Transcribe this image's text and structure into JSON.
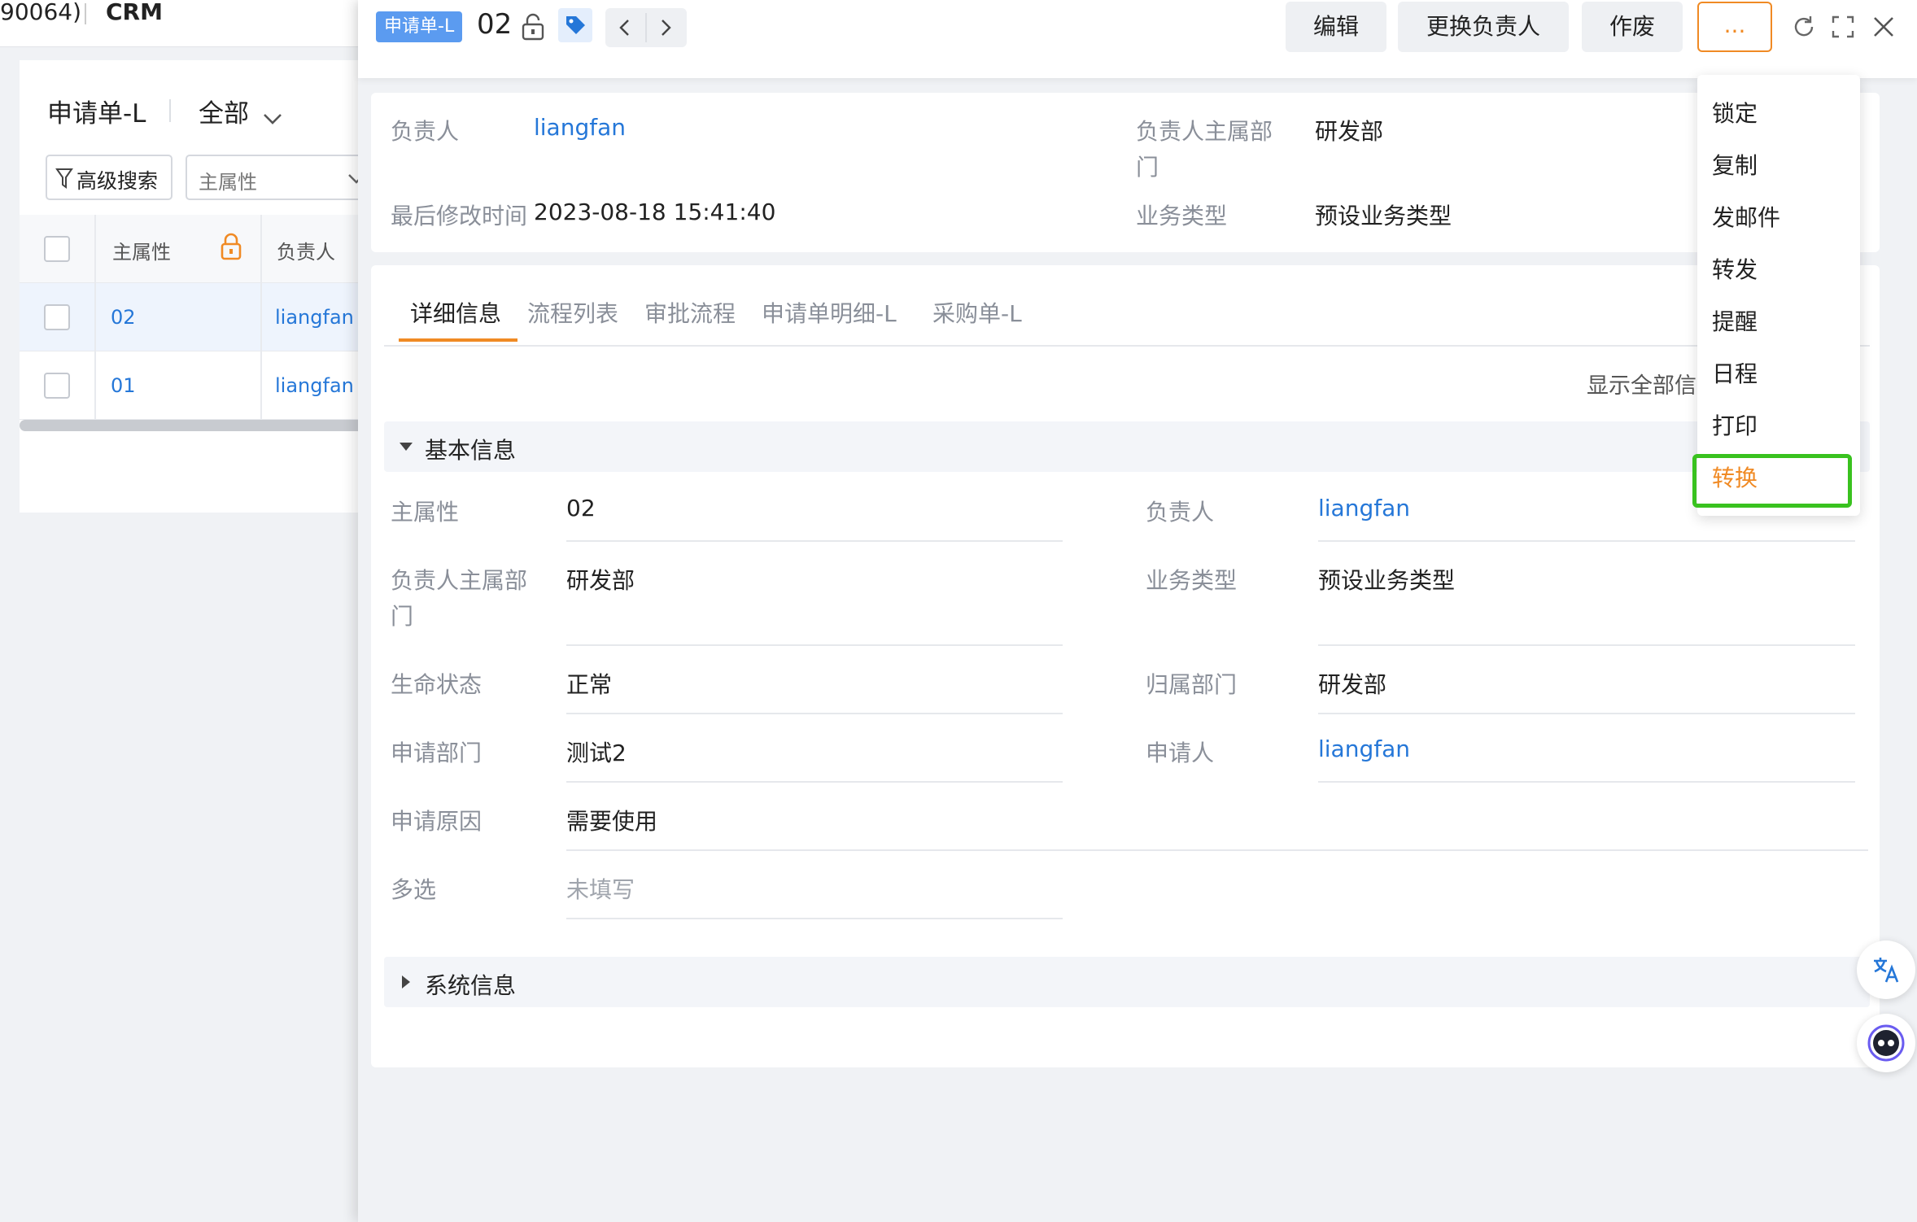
{
  "left_panel": {
    "top_id_text": "90064)",
    "app_name": "CRM",
    "list_title": "申请单-L",
    "scope_label": "全部",
    "advanced_search_label": "高级搜索",
    "field_select_placeholder": "主属性",
    "columns": [
      "主属性",
      "负责人"
    ],
    "rows": [
      {
        "main": "02",
        "owner": "liangfan"
      },
      {
        "main": "01",
        "owner": "liangfan"
      }
    ]
  },
  "detail": {
    "object_tag": "申请单-L",
    "record_id": "02",
    "actions": {
      "edit": "编辑",
      "change_owner": "更换负责人",
      "void": "作废",
      "more": "..."
    },
    "summary": [
      {
        "label": "负责人",
        "value": "liangfan",
        "link": true
      },
      {
        "label": "负责人主属部门",
        "value": "研发部"
      },
      {
        "label": "最后修改时间",
        "value": "2023-08-18 15:41:40"
      },
      {
        "label": "业务类型",
        "value": "预设业务类型"
      }
    ],
    "tabs": [
      "详细信息",
      "流程列表",
      "审批流程",
      "申请单明细-L",
      "采购单-L"
    ],
    "active_tab": 0,
    "show_all_label": "显示全部信",
    "basic_section_title": "基本信息",
    "fields_left": [
      {
        "label": "主属性",
        "value": "02"
      },
      {
        "label": "负责人主属部门",
        "value": "研发部"
      },
      {
        "label": "生命状态",
        "value": "正常"
      },
      {
        "label": "申请部门",
        "value": "测试2"
      },
      {
        "label": "申请原因",
        "value": "需要使用"
      },
      {
        "label": "多选",
        "value": "未填写",
        "empty": true
      }
    ],
    "fields_right": [
      {
        "label": "负责人",
        "value": "liangfan",
        "link": true
      },
      {
        "label": "业务类型",
        "value": "预设业务类型"
      },
      {
        "label": "归属部门",
        "value": "研发部"
      },
      {
        "label": "申请人",
        "value": "liangfan",
        "link": true
      }
    ],
    "system_section_title": "系统信息"
  },
  "more_menu": {
    "items": [
      "锁定",
      "复制",
      "发邮件",
      "转发",
      "提醒",
      "日程",
      "打印",
      "转换"
    ],
    "highlighted_index": 7
  },
  "colors": {
    "accent_orange": "#f08a24",
    "link_blue": "#2577d8",
    "highlight_green": "#39c21f",
    "tag_blue": "#5b9bf0"
  },
  "icons": [
    "unlock-icon",
    "tag-icon",
    "chevron-left-icon",
    "chevron-right-icon",
    "refresh-icon",
    "fullscreen-icon",
    "close-icon",
    "translate-icon",
    "assistant-bot-icon",
    "filter-icon",
    "chevron-down-icon",
    "lock-icon",
    "caret-down-icon",
    "caret-right-icon"
  ]
}
